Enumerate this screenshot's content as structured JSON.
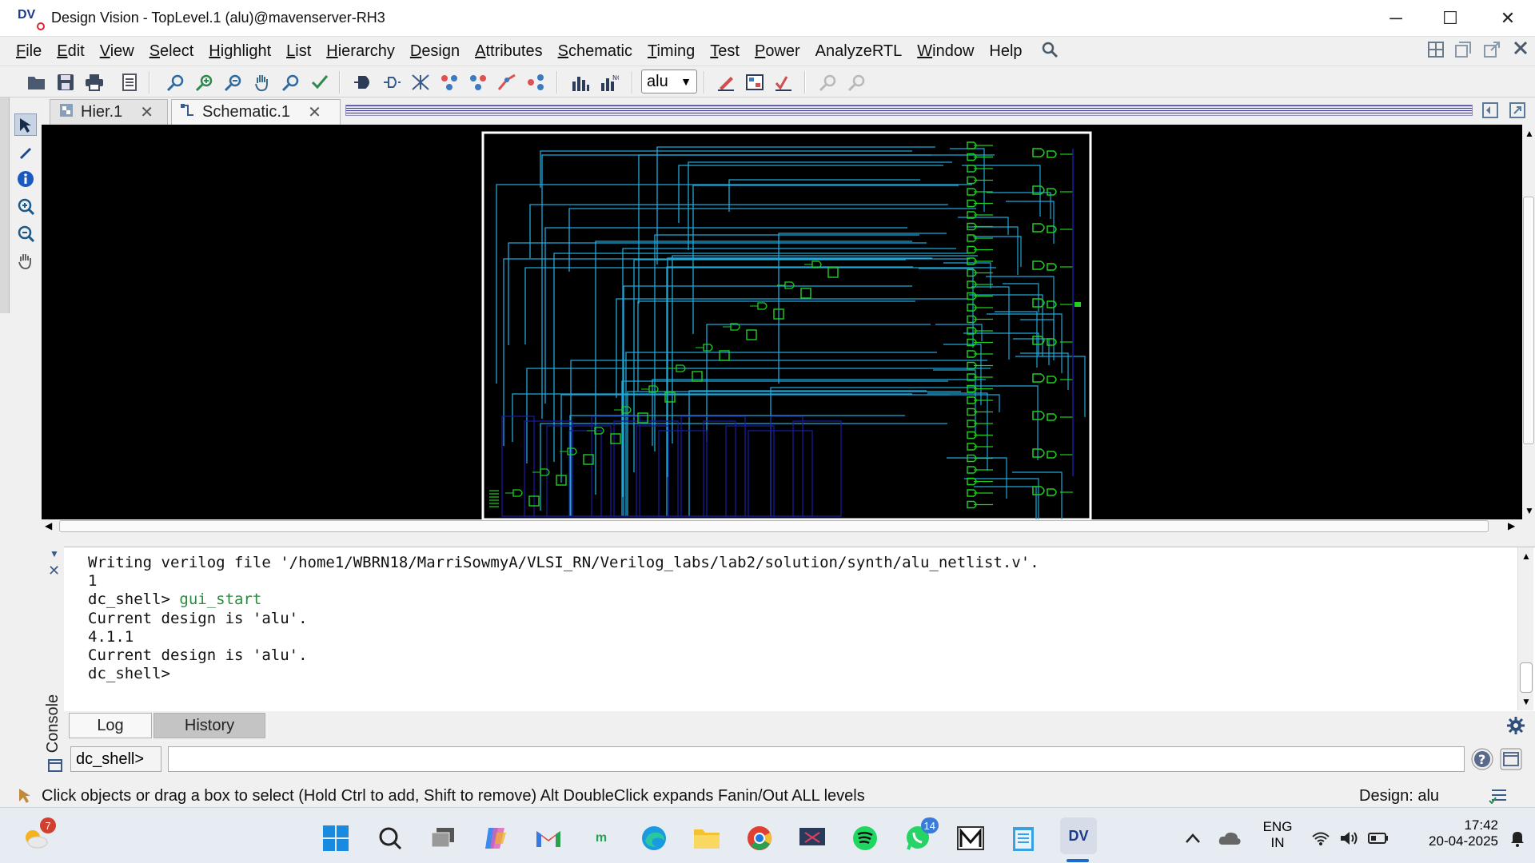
{
  "window": {
    "title": "Design Vision - TopLevel.1 (alu)@mavenserver-RH3",
    "app_logo_text": "DV",
    "controls": {
      "minimize": "─",
      "maximize": "☐",
      "close": "✕"
    }
  },
  "menubar": {
    "items": [
      {
        "label": "File",
        "mnemonic": "F",
        "rest": "ile"
      },
      {
        "label": "Edit",
        "mnemonic": "E",
        "rest": "dit"
      },
      {
        "label": "View",
        "mnemonic": "V",
        "rest": "iew"
      },
      {
        "label": "Select",
        "mnemonic": "S",
        "rest": "elect"
      },
      {
        "label": "Highlight",
        "mnemonic": "H",
        "rest": "ighlight"
      },
      {
        "label": "List",
        "mnemonic": "L",
        "rest": "ist"
      },
      {
        "label": "Hierarchy",
        "mnemonic": "H",
        "rest": "ierarchy"
      },
      {
        "label": "Design",
        "mnemonic": "D",
        "rest": "esign"
      },
      {
        "label": "Attributes",
        "mnemonic": "A",
        "rest": "ttributes"
      },
      {
        "label": "Schematic",
        "mnemonic": "S",
        "rest": "chematic"
      },
      {
        "label": "Timing",
        "mnemonic": "T",
        "rest": "iming"
      },
      {
        "label": "Test",
        "mnemonic": "T",
        "rest": "est"
      },
      {
        "label": "Power",
        "mnemonic": "P",
        "rest": "ower"
      },
      {
        "label": "AnalyzeRTL",
        "mnemonic": "",
        "rest": "AnalyzeRTL"
      },
      {
        "label": "Window",
        "mnemonic": "W",
        "rest": "indow"
      },
      {
        "label": "Help",
        "mnemonic": "",
        "rest": "Help"
      }
    ]
  },
  "toolbar": {
    "design_select_value": "alu"
  },
  "tabs": [
    {
      "label": "Hier.1",
      "active": false
    },
    {
      "label": "Schematic.1",
      "active": true
    }
  ],
  "console": {
    "lines": [
      {
        "text": "Writing verilog file '/home1/WBRN18/MarriSowmyA/VLSI_RN/Verilog_labs/lab2/solution/synth/alu_netlist.v'.",
        "cmd": ""
      },
      {
        "text": "1",
        "cmd": ""
      },
      {
        "text": "dc_shell> ",
        "cmd": "gui_start"
      },
      {
        "text": "Current design is 'alu'.",
        "cmd": ""
      },
      {
        "text": "4.1.1",
        "cmd": ""
      },
      {
        "text": "Current design is 'alu'.",
        "cmd": ""
      },
      {
        "text": "dc_shell>",
        "cmd": ""
      }
    ],
    "side_label": "Console",
    "tabs": [
      "Log",
      "History"
    ],
    "prompt_label": "dc_shell>",
    "input_value": ""
  },
  "statusbar": {
    "hint": "Click objects or drag a box to select (Hold Ctrl to add, Shift to remove) Alt DoubleClick expands Fanin/Out ALL levels",
    "design": "Design: alu"
  },
  "taskbar": {
    "weather_badge": "7",
    "whatsapp_badge": "14",
    "lang_line1": "ENG",
    "lang_line2": "IN",
    "time": "17:42",
    "date": "20-04-2025"
  },
  "colors": {
    "schematic_wire": "#1fa8d8",
    "schematic_cell": "#1fd01f",
    "schematic_bg": "#000000",
    "schematic_frame": "#ffffff",
    "bus_wire": "#1a1aa8",
    "cmd_green": "#2d8a3e"
  }
}
